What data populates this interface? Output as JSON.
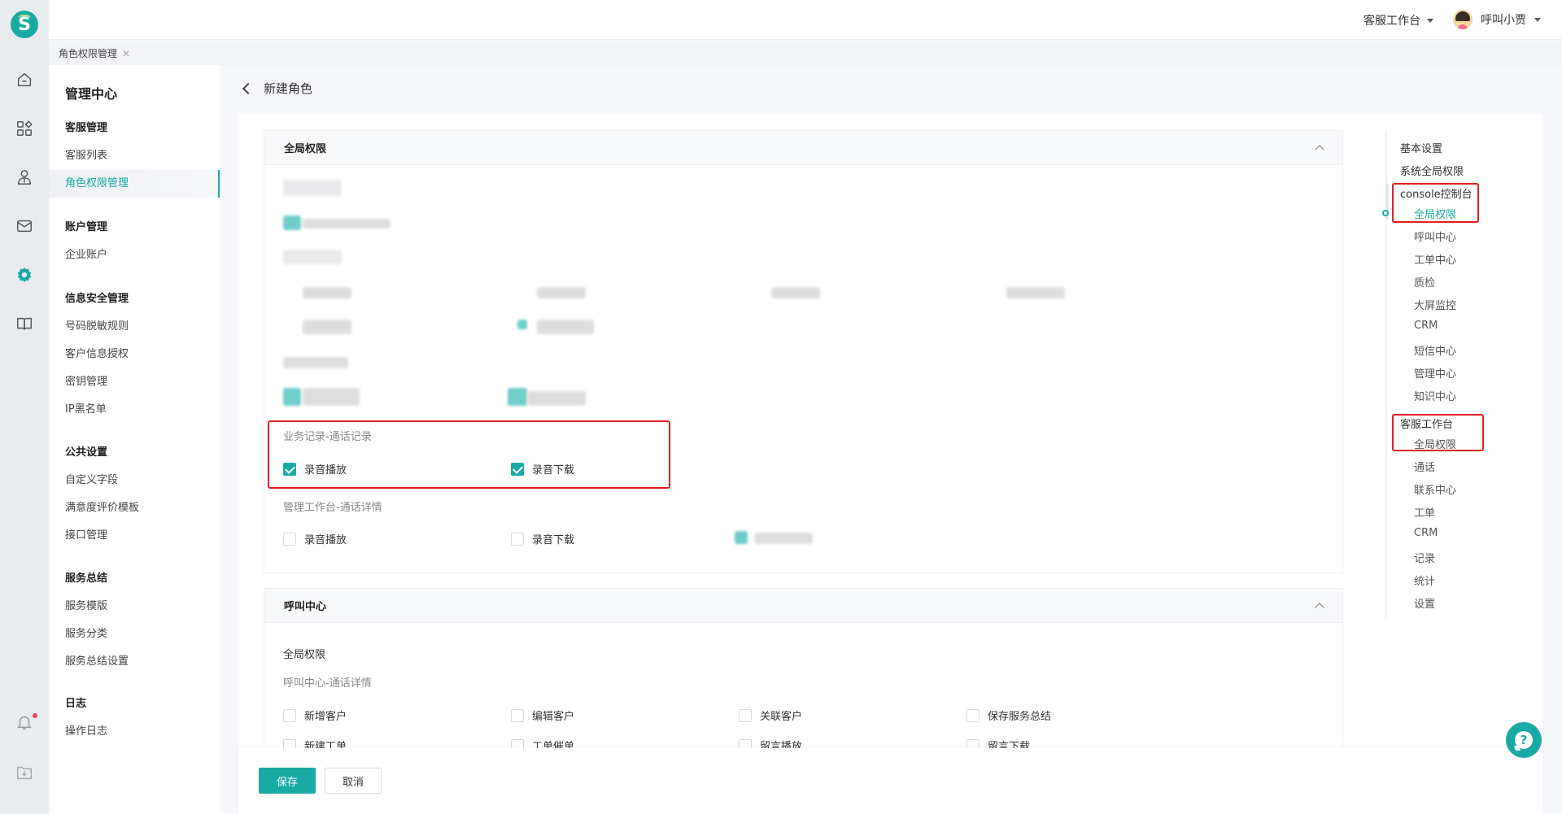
{
  "app": {
    "logo_letter": "S",
    "workspace_switch": "客服工作台",
    "user_name": "呼叫小贾"
  },
  "rail": {
    "icons": [
      "home-icon",
      "apps-icon",
      "user-icon",
      "mail-icon",
      "settings-icon",
      "book-icon",
      "bell-icon",
      "download-folder-icon"
    ],
    "active": "settings-icon",
    "notification_dot": true
  },
  "tabs": [
    {
      "label": "角色权限管理",
      "closable": true
    }
  ],
  "sidebar": {
    "title": "管理中心",
    "groups": [
      {
        "heading": "客服管理",
        "items": [
          "客服列表",
          "角色权限管理"
        ]
      },
      {
        "heading": "账户管理",
        "items": [
          "企业账户"
        ]
      },
      {
        "heading": "信息安全管理",
        "items": [
          "号码脱敏规则",
          "客户信息授权",
          "密钥管理",
          "IP黑名单"
        ]
      },
      {
        "heading": "公共设置",
        "items": [
          "自定义字段",
          "满意度评价模板",
          "接口管理"
        ]
      },
      {
        "heading": "服务总结",
        "items": [
          "服务模版",
          "服务分类",
          "服务总结设置"
        ]
      },
      {
        "heading": "日志",
        "items": [
          "操作日志"
        ]
      }
    ],
    "active_item": "角色权限管理"
  },
  "page": {
    "title": "新建角色",
    "sections": [
      {
        "title": "全局权限",
        "groups": [
          {
            "label": "业务记录-通话记录",
            "options": [
              {
                "label": "录音播放",
                "checked": true
              },
              {
                "label": "录音下载",
                "checked": true
              }
            ]
          },
          {
            "label": "管理工作台-通话详情",
            "options": [
              {
                "label": "录音播放",
                "checked": false
              },
              {
                "label": "录音下载",
                "checked": false
              }
            ]
          }
        ]
      },
      {
        "title": "呼叫中心",
        "subtitle": "全局权限",
        "groups": [
          {
            "label": "呼叫中心-通话详情",
            "options": [
              {
                "label": "新增客户",
                "checked": false
              },
              {
                "label": "编辑客户",
                "checked": false
              },
              {
                "label": "关联客户",
                "checked": false
              },
              {
                "label": "保存服务总结",
                "checked": false
              },
              {
                "label": "新建工单",
                "checked": false
              },
              {
                "label": "工单催单",
                "checked": false
              },
              {
                "label": "留言播放",
                "checked": false
              },
              {
                "label": "留言下载",
                "checked": false
              }
            ]
          }
        ]
      }
    ],
    "save_label": "保存",
    "cancel_label": "取消"
  },
  "anchor_nav": {
    "items": [
      {
        "label": "基本设置",
        "level": 0
      },
      {
        "label": "系统全局权限",
        "level": 0
      },
      {
        "label": "console控制台",
        "level": 0
      },
      {
        "label": "全局权限",
        "level": 1,
        "active": true
      },
      {
        "label": "呼叫中心",
        "level": 1
      },
      {
        "label": "工单中心",
        "level": 1
      },
      {
        "label": "质检",
        "level": 1
      },
      {
        "label": "大屏监控",
        "level": 1
      },
      {
        "label": "CRM",
        "level": 1
      },
      {
        "label": "短信中心",
        "level": 1
      },
      {
        "label": "管理中心",
        "level": 1
      },
      {
        "label": "知识中心",
        "level": 1
      },
      {
        "label": "客服工作台",
        "level": 0
      },
      {
        "label": "全局权限",
        "level": 1
      },
      {
        "label": "通话",
        "level": 1
      },
      {
        "label": "联系中心",
        "level": 1
      },
      {
        "label": "工单",
        "level": 1
      },
      {
        "label": "CRM",
        "level": 1
      },
      {
        "label": "记录",
        "level": 1
      },
      {
        "label": "统计",
        "level": 1
      },
      {
        "label": "设置",
        "level": 1
      }
    ]
  },
  "colors": {
    "accent": "#19aaa6",
    "highlight_box": "#e02020",
    "notification": "#f0455b"
  },
  "help": {
    "icon": "help-chat-icon",
    "glyph": "?"
  }
}
